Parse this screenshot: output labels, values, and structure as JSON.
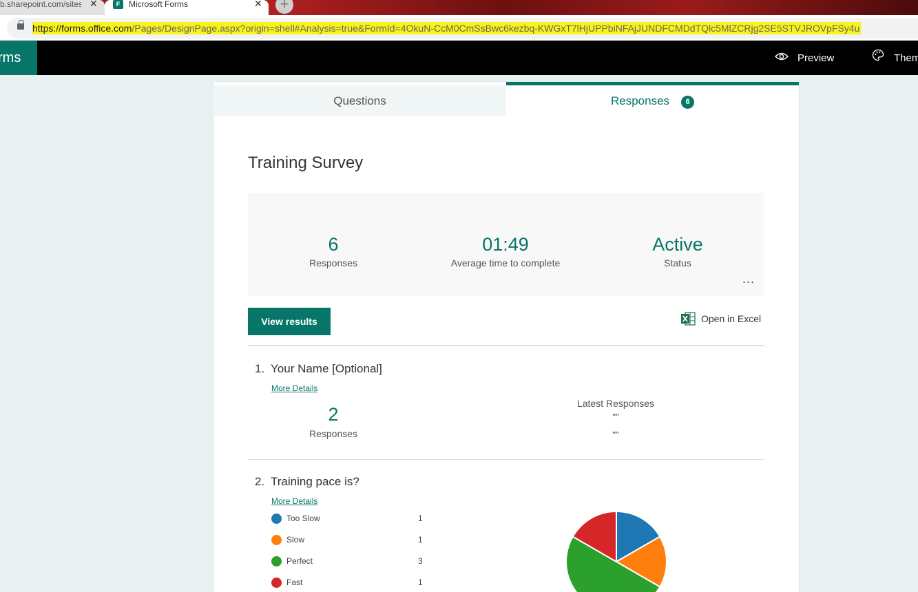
{
  "browser": {
    "tab1_title": "b.sharepoint.com/sites",
    "tab2_title": "Microsoft Forms",
    "favicon_text": "F",
    "close_glyph": "✕",
    "new_tab_glyph": "+",
    "url_host": "https://forms.office.com",
    "url_path": "/Pages/DesignPage.aspx?origin=shell#Analysis=true&FormId=4OkuN-CcM0CmSsBwc6kezbq-KWGxT7lHjUPPbiNFAjJUNDFCMDdTQlc5MlZCRjg2SE5STVJROVpFSy4u"
  },
  "appbar": {
    "brand": "rms",
    "preview_label": "Preview",
    "preview_icon": "eye-icon",
    "theme_label": "Theme",
    "theme_icon": "palette-icon"
  },
  "tabs": {
    "questions": "Questions",
    "responses": "Responses",
    "responses_count": "6"
  },
  "survey": {
    "title": "Training Survey",
    "stats": [
      {
        "value": "6",
        "label": "Responses"
      },
      {
        "value": "01:49",
        "label": "Average time to complete"
      },
      {
        "value": "Active",
        "label": "Status"
      }
    ],
    "more_glyph": "...",
    "view_results": "View results",
    "open_excel": "Open in Excel",
    "excel_icon": "excel-icon"
  },
  "questions": [
    {
      "number": "1.",
      "title": "Your Name [Optional]",
      "more_details": "More Details",
      "count_value": "2",
      "count_label": "Responses",
      "latest_heading": "Latest Responses",
      "latest": [
        "\"\"",
        "\"\""
      ]
    },
    {
      "number": "2.",
      "title": "Training pace is?",
      "more_details": "More Details",
      "options": [
        {
          "label": "Too Slow",
          "count": "1",
          "color": "#1f77b4"
        },
        {
          "label": "Slow",
          "count": "1",
          "color": "#ff7f0e"
        },
        {
          "label": "Perfect",
          "count": "3",
          "color": "#2ca02c"
        },
        {
          "label": "Fast",
          "count": "1",
          "color": "#d62728"
        }
      ]
    }
  ],
  "chart_data": {
    "type": "pie",
    "categories": [
      "Too Slow",
      "Slow",
      "Perfect",
      "Fast"
    ],
    "values": [
      1,
      1,
      3,
      1
    ],
    "colors": [
      "#1f77b4",
      "#ff7f0e",
      "#2ca02c",
      "#d62728"
    ]
  }
}
